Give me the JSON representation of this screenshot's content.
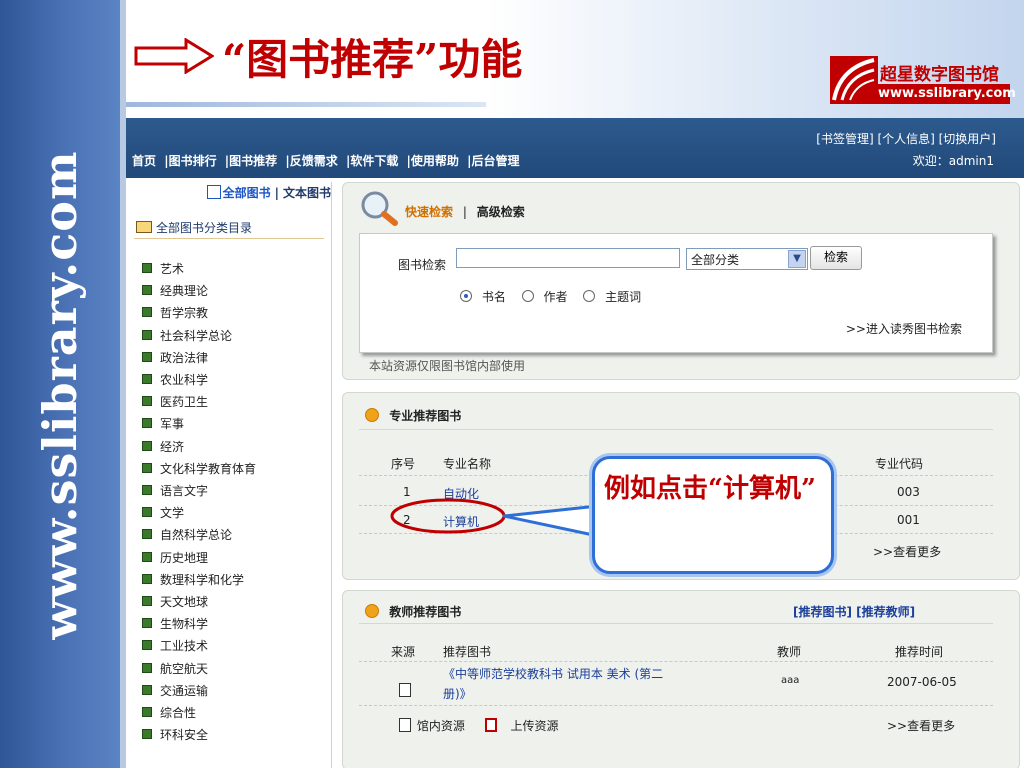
{
  "slide": {
    "title": "“图书推荐”功能",
    "watermark": "www.sslibrary.com",
    "logo_cn": "超星数字图书馆",
    "logo_url": "www.sslibrary.com",
    "callout": "例如点击“计算机”"
  },
  "nav": {
    "links": [
      "首页",
      "|图书排行",
      "|图书推荐",
      "|反馈需求",
      "|软件下载",
      "|使用帮助",
      "|后台管理"
    ],
    "right_links": "[书签管理]  [个人信息] [切换用户]",
    "welcome": "欢迎：admin1"
  },
  "sidebar": {
    "tab_all": "全部图书",
    "tab_sep": "|",
    "tab_text": "文本图书",
    "root": "全部图书分类目录",
    "categories": [
      "艺术",
      "经典理论",
      "哲学宗教",
      "社会科学总论",
      "政治法律",
      "农业科学",
      "医药卫生",
      "军事",
      "经济",
      "文化科学教育体育",
      "语言文字",
      "文学",
      "自然科学总论",
      "历史地理",
      "数理科学和化学",
      "天文地球",
      "生物科学",
      "工业技术",
      "航空航天",
      "交通运输",
      "综合性",
      "环科安全"
    ]
  },
  "search": {
    "tab_quick": "快速检索",
    "tab_sep": "|",
    "tab_advanced": "高级检索",
    "label": "图书检索",
    "input_value": "",
    "select_value": "全部分类",
    "button": "检索",
    "radios": [
      "书名",
      "作者",
      "主题词"
    ],
    "selected_radio": "书名",
    "duxiu_link": ">>进入读秀图书检索",
    "notice": "本站资源仅限图书馆内部使用"
  },
  "major": {
    "title": "专业推荐图书",
    "col_no": "序号",
    "col_name": "专业名称",
    "col_code": "专业代码",
    "rows": [
      {
        "no": "1",
        "name": "自动化",
        "code": "003"
      },
      {
        "no": "2",
        "name": "计算机",
        "code": "001"
      }
    ],
    "more": ">>查看更多"
  },
  "teacher": {
    "title": "教师推荐图书",
    "link_books": "[推荐图书]",
    "link_teachers": "[推荐教师]",
    "col_source": "来源",
    "col_book": "推荐图书",
    "col_teacher": "教师",
    "col_time": "推荐时间",
    "rows": [
      {
        "book_line1": "《中等师范学校教科书 试用本 美术 (第二",
        "book_line2": "册)》",
        "teacher": "aaa",
        "time": "2007-06-05"
      }
    ],
    "legend_local": "馆内资源",
    "legend_upload": "上传资源",
    "more": ">>查看更多"
  },
  "colors": {
    "accent_red": "#c00000",
    "nav_blue": "#21497a",
    "callout_border": "#2d6fd6",
    "link_blue": "#1c3f9a"
  }
}
